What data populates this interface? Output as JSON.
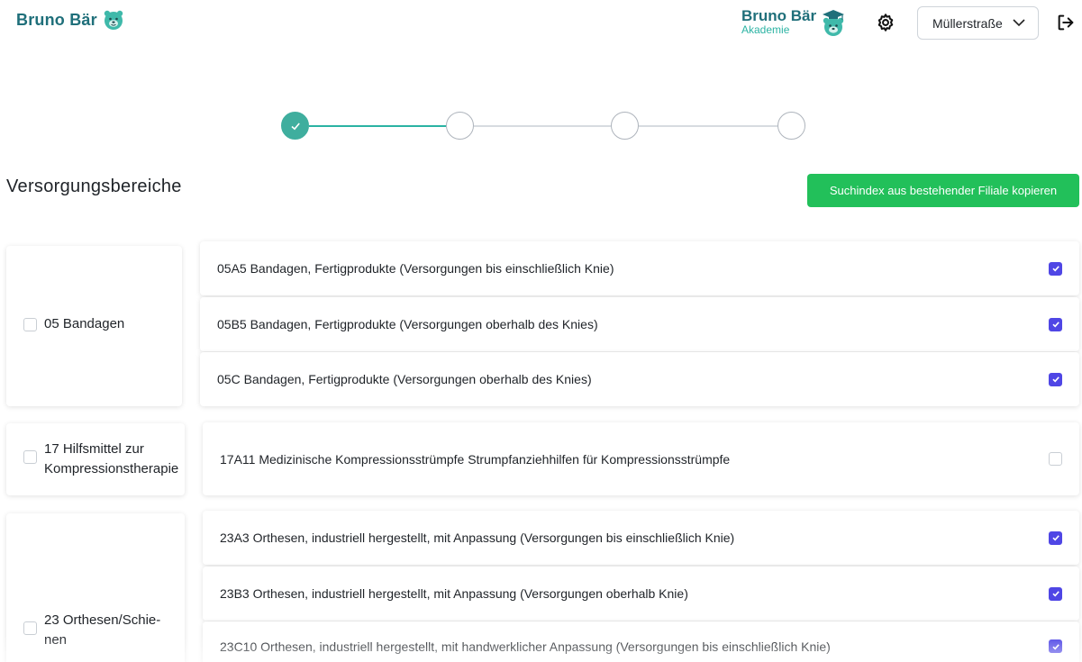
{
  "header": {
    "brand_name": "Bruno Bär",
    "academy_name": "Bruno Bär",
    "academy_sub": "Akademie",
    "branch_value": "Müllerstraße",
    "icons": [
      "bear-icon",
      "graduation-bear-icon",
      "gear-icon",
      "chevron-down-icon",
      "logout-icon"
    ]
  },
  "stepper": {
    "total_steps": 4,
    "completed_steps": 1,
    "accent_color": "#3fae9e"
  },
  "page": {
    "title": "Versorgungsbereiche",
    "copy_button_label": "Suchindex aus bestehender Filiale kopieren",
    "copy_button_color": "#22c05a",
    "checkbox_color": "#4f46e5"
  },
  "groups": [
    {
      "label": "05 Bandagen",
      "checked": false,
      "items": [
        {
          "label": "05A5 Bandagen, Fertigprodukte (Versorgungen bis einschließlich Knie)",
          "checked": true
        },
        {
          "label": "05B5 Bandagen, Fertigprodukte (Versorgungen oberhalb des Knies)",
          "checked": true
        },
        {
          "label": "05C Bandagen, Fertigprodukte (Versorgungen oberhalb des Knies)",
          "checked": true
        }
      ]
    },
    {
      "label_line1": "17 Hilfsmittel zur",
      "label_line2": "Kompressionstherapie",
      "checked": false,
      "items": [
        {
          "label": "17A11 Medizinische Kompressionsstrümpfe Strumpfanziehhilfen für Kompressionsstrümpfe",
          "checked": false
        }
      ]
    },
    {
      "label_line1": "23 Orthesen/Schie-",
      "label_line2": "nen",
      "checked": false,
      "items": [
        {
          "label": "23A3 Orthesen, industriell hergestellt, mit Anpassung (Versorgungen bis einschließlich Knie)",
          "checked": true
        },
        {
          "label": "23B3 Orthesen, industriell hergestellt, mit Anpassung (Versorgungen oberhalb Knie)",
          "checked": true
        },
        {
          "label": "23C10 Orthesen, industriell hergestellt, mit handwerklicher Anpassung (Versorgungen bis einschließlich Knie)",
          "checked": true
        }
      ]
    }
  ]
}
